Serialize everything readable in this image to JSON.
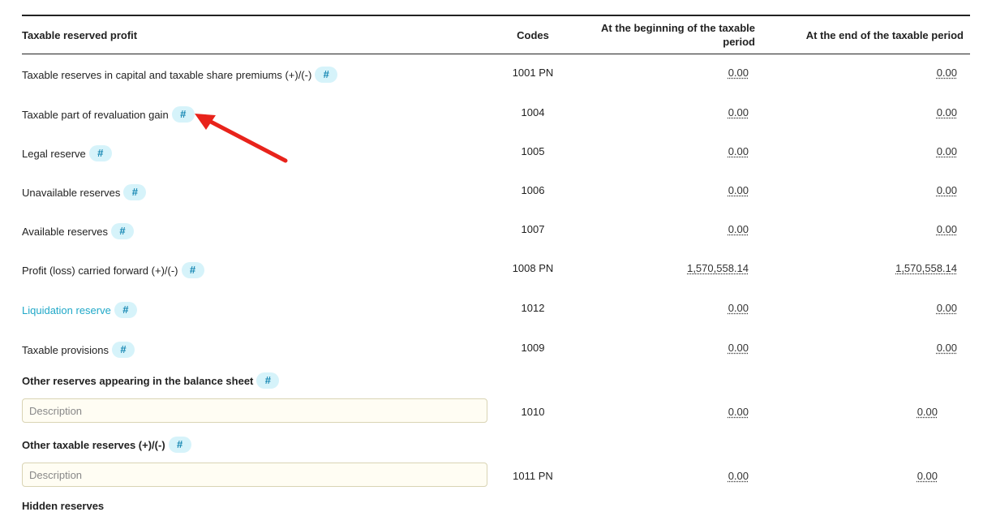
{
  "header": {
    "label": "Taxable reserved profit",
    "codes": "Codes",
    "begin_line1": "At the beginning of the taxable",
    "begin_line2": "period",
    "end": "At the end of the taxable period"
  },
  "hash_symbol": "#",
  "rows": [
    {
      "label": "Taxable reserves in capital and taxable share premiums (+)/(-)",
      "code": "1001 PN",
      "begin": "0.00",
      "end": "0.00"
    },
    {
      "label": "Taxable part of revaluation gain",
      "code": "1004",
      "begin": "0.00",
      "end": "0.00"
    },
    {
      "label": "Legal reserve",
      "code": "1005",
      "begin": "0.00",
      "end": "0.00"
    },
    {
      "label": "Unavailable reserves",
      "code": "1006",
      "begin": "0.00",
      "end": "0.00"
    },
    {
      "label": "Available reserves",
      "code": "1007",
      "begin": "0.00",
      "end": "0.00"
    },
    {
      "label": "Profit (loss) carried forward (+)/(-)",
      "code": "1008 PN",
      "begin": "1,570,558.14",
      "end": "1,570,558.14"
    },
    {
      "label": "Liquidation reserve",
      "code": "1012",
      "begin": "0.00",
      "end": "0.00"
    },
    {
      "label": "Taxable provisions",
      "code": "1009",
      "begin": "0.00",
      "end": "0.00"
    }
  ],
  "other_reserves": {
    "title": "Other reserves appearing in the balance sheet",
    "placeholder": "Description",
    "code": "1010",
    "begin": "0.00",
    "end": "0.00"
  },
  "other_taxable": {
    "title": "Other taxable reserves (+)/(-)",
    "placeholder": "Description",
    "code": "1011 PN",
    "begin": "0.00",
    "end": "0.00"
  },
  "hidden_reserves": {
    "title": "Hidden reserves"
  },
  "colors": {
    "link": "#20a8c8",
    "hash_bg": "#d6f3fa",
    "hash_fg": "#1687b3",
    "input_bg": "#fffdf3",
    "arrow": "#e8231b"
  }
}
